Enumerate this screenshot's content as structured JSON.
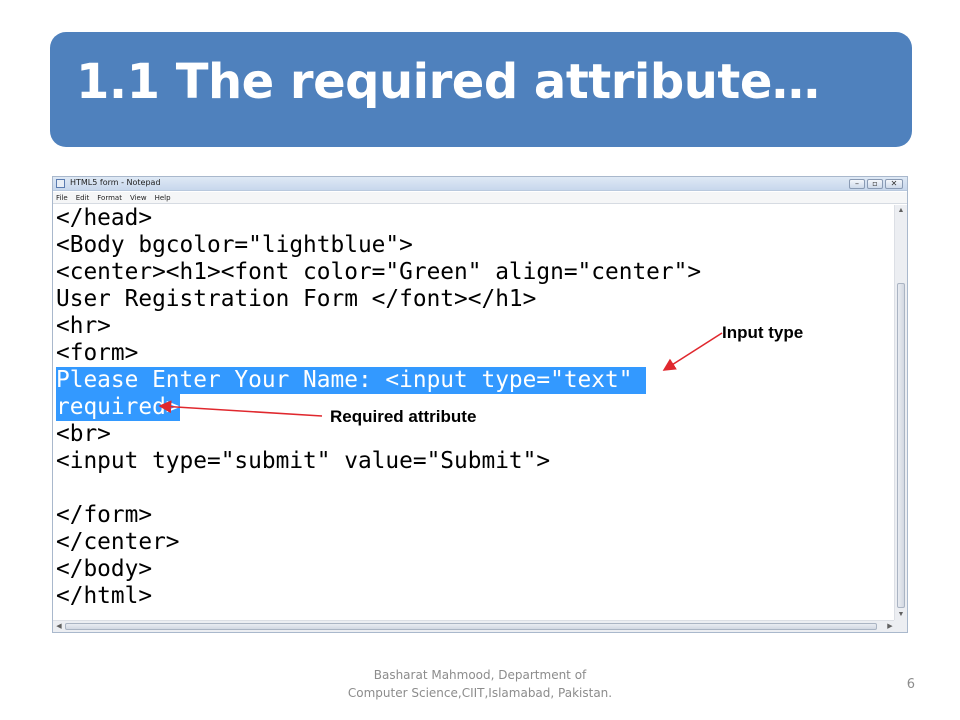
{
  "slide": {
    "title": "1.1 The required attribute…",
    "title_bg_color": "#4f81bd",
    "footer_line1": "Basharat Mahmood, Department of",
    "footer_line2": "Computer Science,CIIT,Islamabad, Pakistan.",
    "page_number": "6"
  },
  "notepad": {
    "window_title": "HTML5 form - Notepad",
    "window_buttons": [
      "minimize-icon",
      "maximize-icon",
      "close-icon"
    ],
    "menu": [
      "File",
      "Edit",
      "Format",
      "View",
      "Help"
    ],
    "selection_color": "#3399ff",
    "code_lines": [
      "</head>",
      "<Body bgcolor=\"lightblue\">",
      "<center><h1><font color=\"Green\" align=\"center\">",
      "User Registration Form </font></h1>",
      "<hr>",
      "<form>",
      "Please Enter Your Name: <input type=\"text\" ",
      "required>",
      "<br>",
      "<input type=\"submit\" value=\"Submit\">",
      "",
      "</form>",
      "</center>",
      "</body>",
      "</html>"
    ]
  },
  "annotations": {
    "input_type": "Input type",
    "required_attribute": "Required attribute",
    "arrow_color": "#e0282e"
  }
}
